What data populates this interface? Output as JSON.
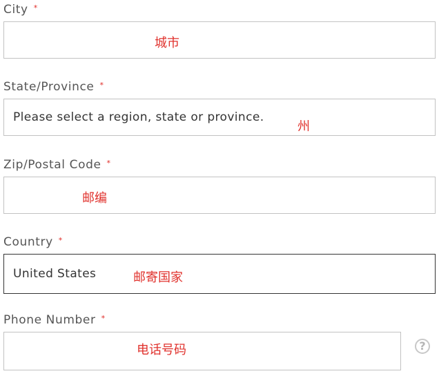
{
  "form": {
    "city": {
      "label": "City",
      "required_mark": "*",
      "value": "",
      "annotation": "城市"
    },
    "state": {
      "label": "State/Province",
      "required_mark": "*",
      "value": "Please select a region, state or province.",
      "annotation": "州"
    },
    "zip": {
      "label": "Zip/Postal Code",
      "required_mark": "*",
      "value": "",
      "annotation": "邮编"
    },
    "country": {
      "label": "Country",
      "required_mark": "*",
      "value": "United States",
      "annotation": "邮寄国家"
    },
    "phone": {
      "label": "Phone Number",
      "required_mark": "*",
      "value": "",
      "annotation": "电话号码",
      "help_glyph": "?"
    }
  },
  "icons": {
    "help": "question-circle-icon"
  },
  "colors": {
    "required": "#e02b27",
    "annotation": "#e0312c",
    "border": "#c2c2c2",
    "border_focused": "#333333"
  }
}
